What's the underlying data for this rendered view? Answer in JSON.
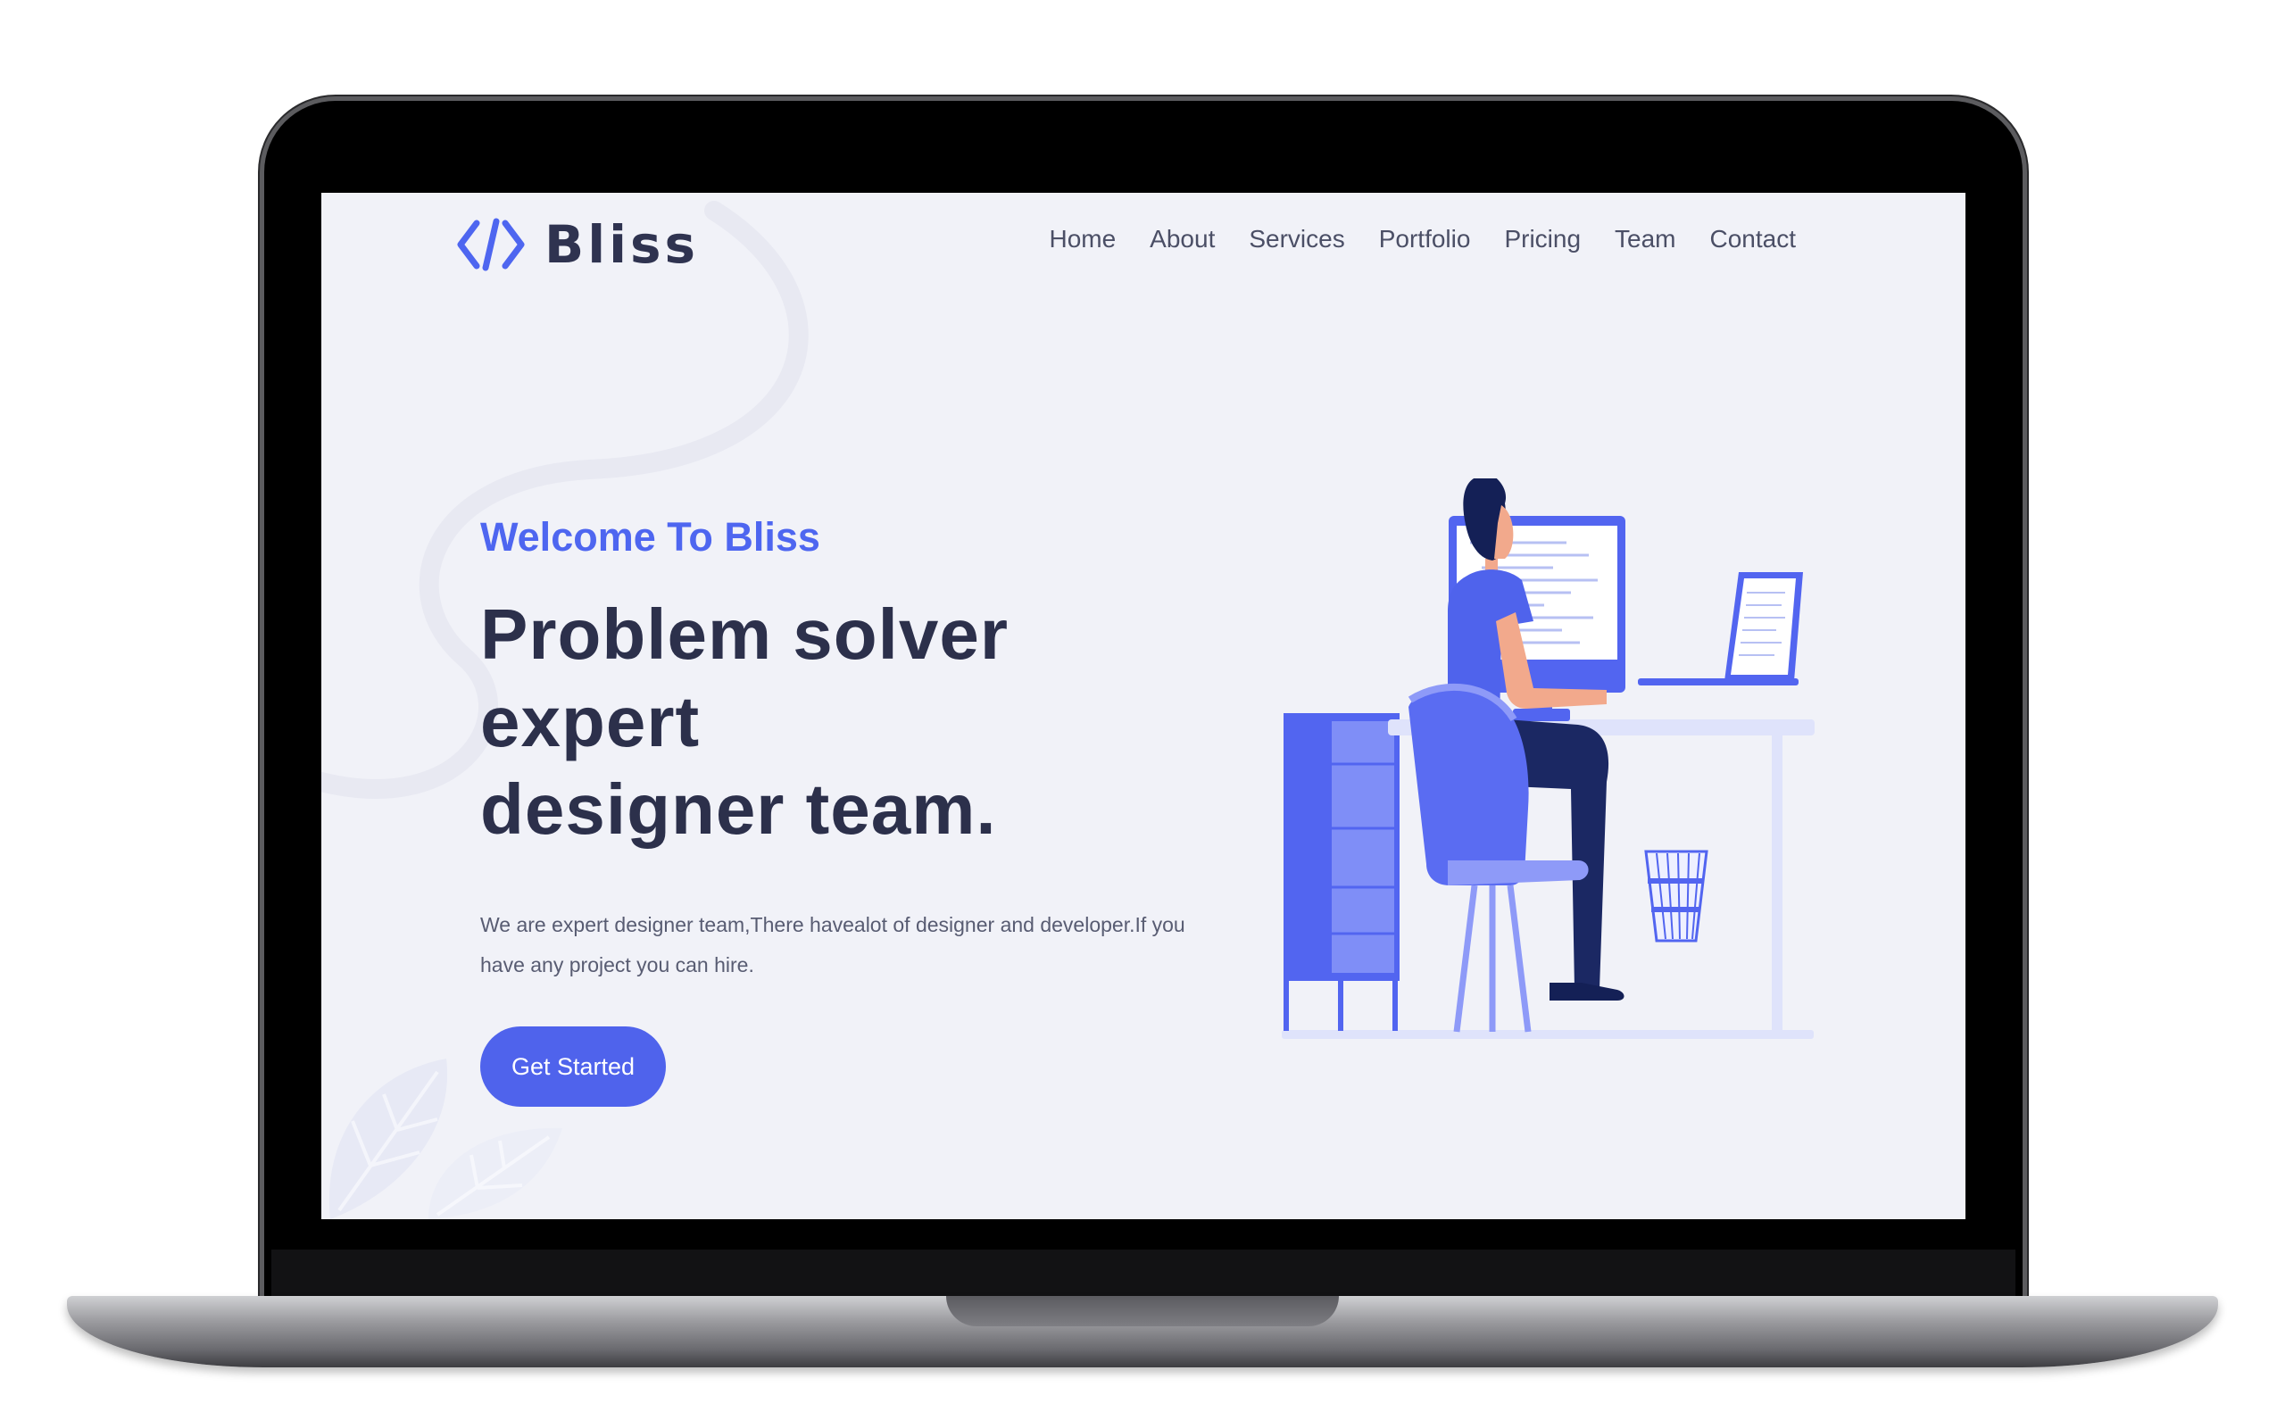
{
  "brand": {
    "name": "Bliss",
    "logo_icon": "code-brackets-icon",
    "accent": "#4e66f0"
  },
  "nav": {
    "items": [
      {
        "label": "Home"
      },
      {
        "label": "About"
      },
      {
        "label": "Services"
      },
      {
        "label": "Portfolio"
      },
      {
        "label": "Pricing"
      },
      {
        "label": "Team"
      },
      {
        "label": "Contact"
      }
    ]
  },
  "hero": {
    "welcome": "Welcome To Bliss",
    "headline_line1": "Problem solver expert",
    "headline_line2": "designer team.",
    "description_line1": "We are expert designer team,There havealot of designer and developer.If you",
    "description_line2": "have any project you can hire.",
    "cta_label": "Get Started",
    "illustration": "person-at-desk-illustration"
  },
  "colors": {
    "background": "#f1f2f8",
    "primary": "#4f63ec",
    "heading": "#2c304b"
  }
}
